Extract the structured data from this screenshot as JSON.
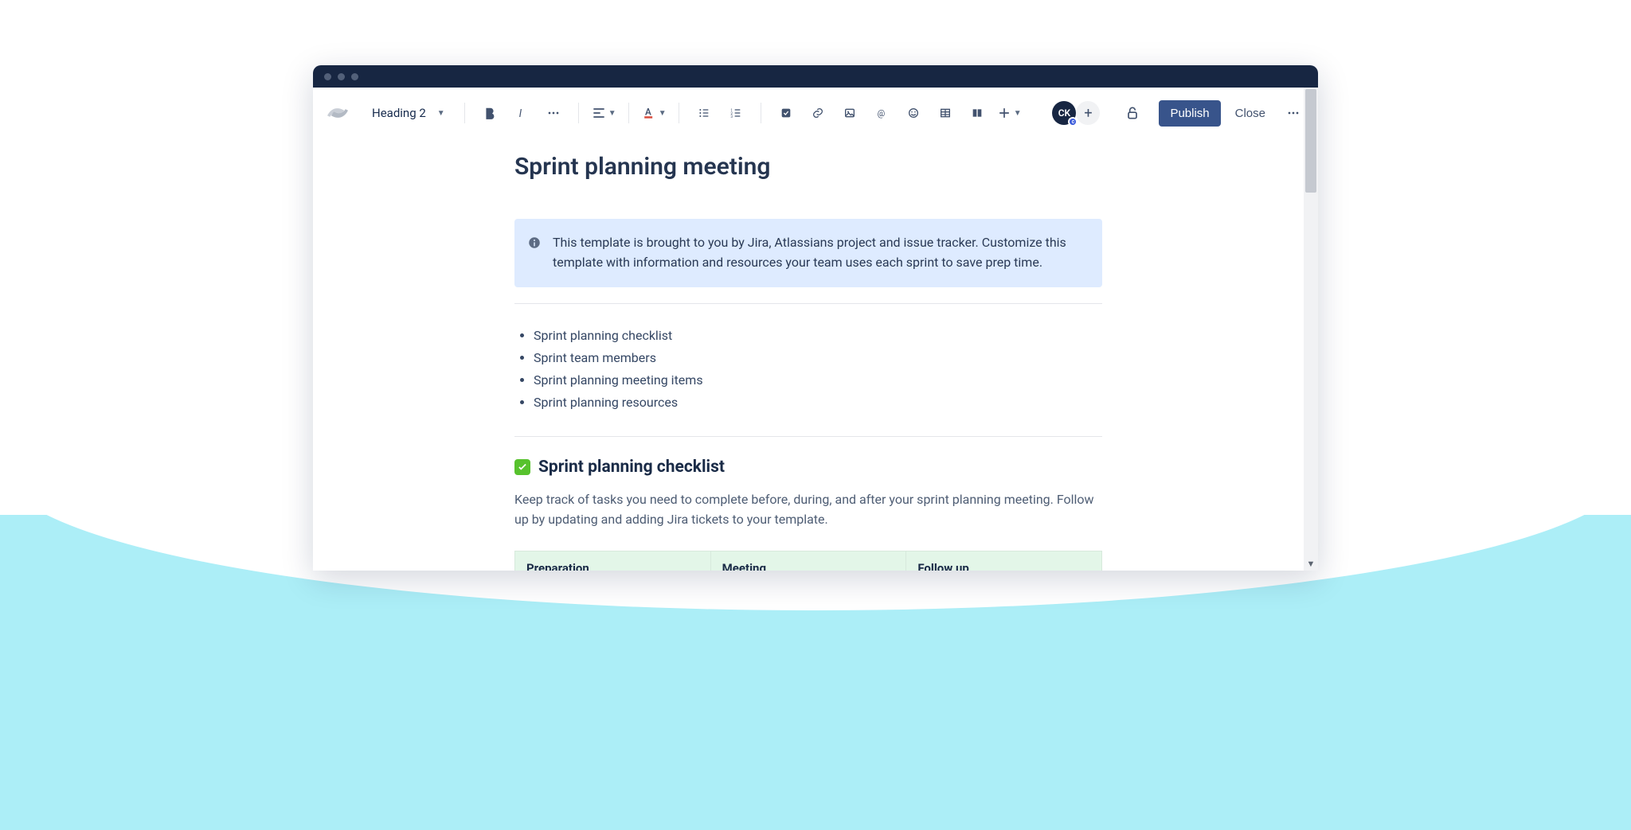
{
  "toolbar": {
    "text_style": "Heading 2",
    "avatar_initials": "CK",
    "avatar_status": "c",
    "publish_label": "Publish",
    "close_label": "Close"
  },
  "page": {
    "title": "Sprint planning meeting",
    "info_panel": "This template is brought to you by Jira, Atlassians project and issue tracker. Customize this template with information and resources your team uses each sprint to save prep time.",
    "toc": [
      "Sprint planning checklist",
      "Sprint team members",
      "Sprint planning meeting items",
      "Sprint planning resources"
    ],
    "section1": {
      "heading": "Sprint planning checklist",
      "description": "Keep track of tasks you need to complete before, during, and after your sprint planning meeting. Follow up by updating and adding Jira tickets to your template.",
      "columns": [
        "Preparation",
        "Meeting",
        "Follow up"
      ]
    }
  }
}
